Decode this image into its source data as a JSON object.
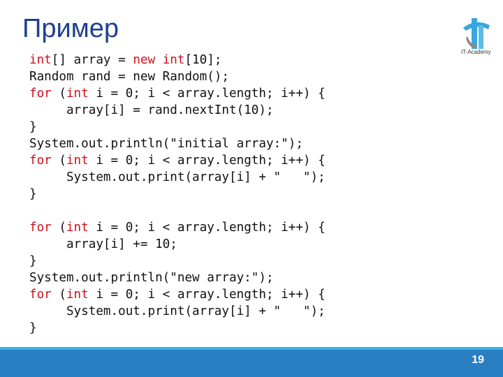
{
  "title": "Пример",
  "logo": {
    "text": "IT-Academy",
    "colors": {
      "primary": "#3aa6e0",
      "secondary": "#888888"
    }
  },
  "code": {
    "keyword_color": "#d0101a",
    "lines": [
      [
        {
          "t": "int",
          "k": 1
        },
        {
          "t": "[] array = "
        },
        {
          "t": "new",
          "k": 1
        },
        {
          "t": " "
        },
        {
          "t": "int",
          "k": 1
        },
        {
          "t": "[10];"
        }
      ],
      [
        {
          "t": "Random rand = new Random();"
        }
      ],
      [
        {
          "t": "for",
          "k": 1
        },
        {
          "t": " ("
        },
        {
          "t": "int",
          "k": 1
        },
        {
          "t": " i = 0; i < array.length; i++) {"
        }
      ],
      [
        {
          "t": "     array[i] = rand.nextInt(10);"
        }
      ],
      [
        {
          "t": "}"
        }
      ],
      [
        {
          "t": "System.out.println(\"initial array:\");"
        }
      ],
      [
        {
          "t": "for",
          "k": 1
        },
        {
          "t": " ("
        },
        {
          "t": "int",
          "k": 1
        },
        {
          "t": " i = 0; i < array.length; i++) {"
        }
      ],
      [
        {
          "t": "     System.out.print(array[i] + \"   \");"
        }
      ],
      [
        {
          "t": "}"
        }
      ],
      [],
      [
        {
          "t": "for",
          "k": 1
        },
        {
          "t": " ("
        },
        {
          "t": "int",
          "k": 1
        },
        {
          "t": " i = 0; i < array.length; i++) {"
        }
      ],
      [
        {
          "t": "     array[i] += 10;"
        }
      ],
      [
        {
          "t": "}"
        }
      ],
      [
        {
          "t": "System.out.println(\"new array:\");"
        }
      ],
      [
        {
          "t": "for",
          "k": 1
        },
        {
          "t": " ("
        },
        {
          "t": "int",
          "k": 1
        },
        {
          "t": " i = 0; i < array.length; i++) {"
        }
      ],
      [
        {
          "t": "     System.out.print(array[i] + \"   \");"
        }
      ],
      [
        {
          "t": "}"
        }
      ]
    ]
  },
  "footer": {
    "page_number": "19",
    "color": "#2a7fc2"
  }
}
